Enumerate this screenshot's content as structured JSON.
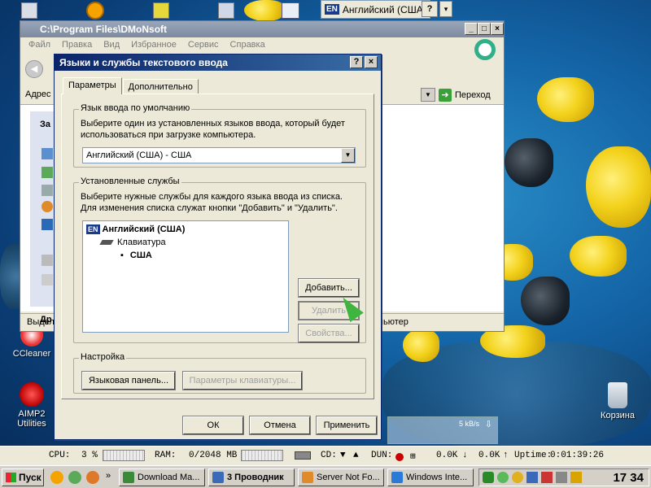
{
  "language_bar": {
    "code": "EN",
    "label": "Английский (США)",
    "help": "?"
  },
  "desktop_icons": [
    {
      "label": "CCleaner"
    },
    {
      "label": "AIMP2 Utilities"
    },
    {
      "label": "Корзина"
    }
  ],
  "explorer": {
    "title": "C:\\Program Files\\DMoNsoft",
    "menu": [
      "Файл",
      "Правка",
      "Вид",
      "Избранное",
      "Сервис",
      "Справка"
    ],
    "address_label": "Адрес",
    "go_label": "Переход",
    "status_left": "Выделе",
    "status_right": "пьютер"
  },
  "dialog": {
    "title": "Языки и службы текстового ввода",
    "tabs": [
      "Параметры",
      "Дополнительно"
    ],
    "default_lang": {
      "title": "Язык ввода по умолчанию",
      "desc1": "Выберите один из установленных языков ввода, который будет",
      "desc2": "использоваться при загрузке компьютера.",
      "value": "Английский (США) - США"
    },
    "services": {
      "title": "Установленные службы",
      "desc1": "Выберите нужные службы для каждого языка ввода из списка.",
      "desc2": "Для изменения списка служат кнопки \"Добавить\" и \"Удалить\".",
      "tree": {
        "code": "EN",
        "lang": "Английский (США)",
        "category": "Клавиатура",
        "layout": "США"
      },
      "add": "Добавить...",
      "remove": "Удалить",
      "properties": "Свойства..."
    },
    "settings": {
      "title": "Настройка",
      "langbar_btn": "Языковая панель...",
      "keyboard_btn": "Параметры клавиатуры..."
    },
    "ok": "ОК",
    "cancel": "Отмена",
    "apply": "Применить"
  },
  "net_widget": {
    "rate": "5 kB/s"
  },
  "sysbar": {
    "cpu_label": "CPU:",
    "cpu_value": "3 %",
    "ram_label": "RAM:",
    "ram_value": "0/2048 MB",
    "cd_label": "CD:",
    "dun_label": "DUN:",
    "down": "0.0K",
    "up": "0.0K",
    "uptime_label": "Uptime:",
    "uptime_value": "0:01:39:26"
  },
  "taskbar": {
    "start": "Пуск",
    "tasks": [
      "Download Ma...",
      "3 Проводник",
      "Server Not Fo...",
      "Windows Inte..."
    ],
    "clock": "17 34"
  }
}
